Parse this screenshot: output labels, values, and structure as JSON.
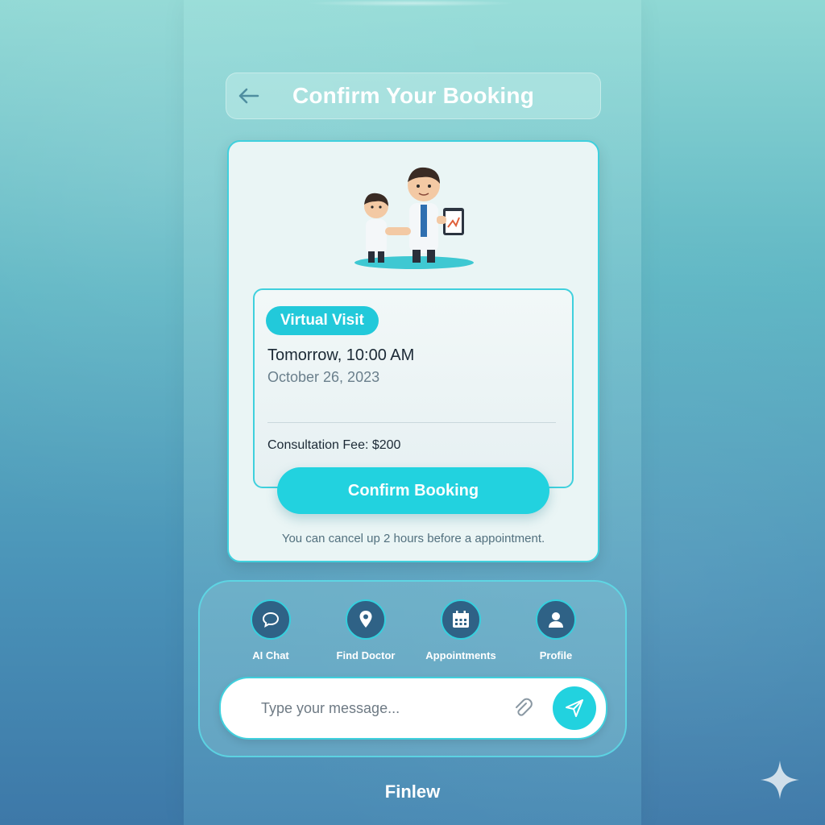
{
  "header": {
    "title": "Confirm Your Booking"
  },
  "booking": {
    "visit_type": "Virtual Visit",
    "time": "Tomorrow, 10:00 AM",
    "date": "October 26, 2023",
    "fee": "Consultation Fee: $200",
    "confirm_label": "Confirm Booking",
    "cancel_note": "You can cancel up 2 hours before a appointment."
  },
  "nav": {
    "items": [
      {
        "label": "AI Chat",
        "icon": "chat-bubble-icon"
      },
      {
        "label": "Find Doctor",
        "icon": "location-pin-icon"
      },
      {
        "label": "Appointments",
        "icon": "calendar-icon"
      },
      {
        "label": "Profile",
        "icon": "user-icon"
      }
    ]
  },
  "message": {
    "placeholder": "Type your message...",
    "attach_icon": "paperclip-icon",
    "send_icon": "paper-plane-icon"
  },
  "brand": {
    "name": "Finlew"
  },
  "colors": {
    "accent": "#22d2df",
    "accent_border": "#3fd0dd",
    "nav_circle": "#2f6286",
    "text_dark": "#1c2a36",
    "text_muted": "#6a7f8c"
  }
}
